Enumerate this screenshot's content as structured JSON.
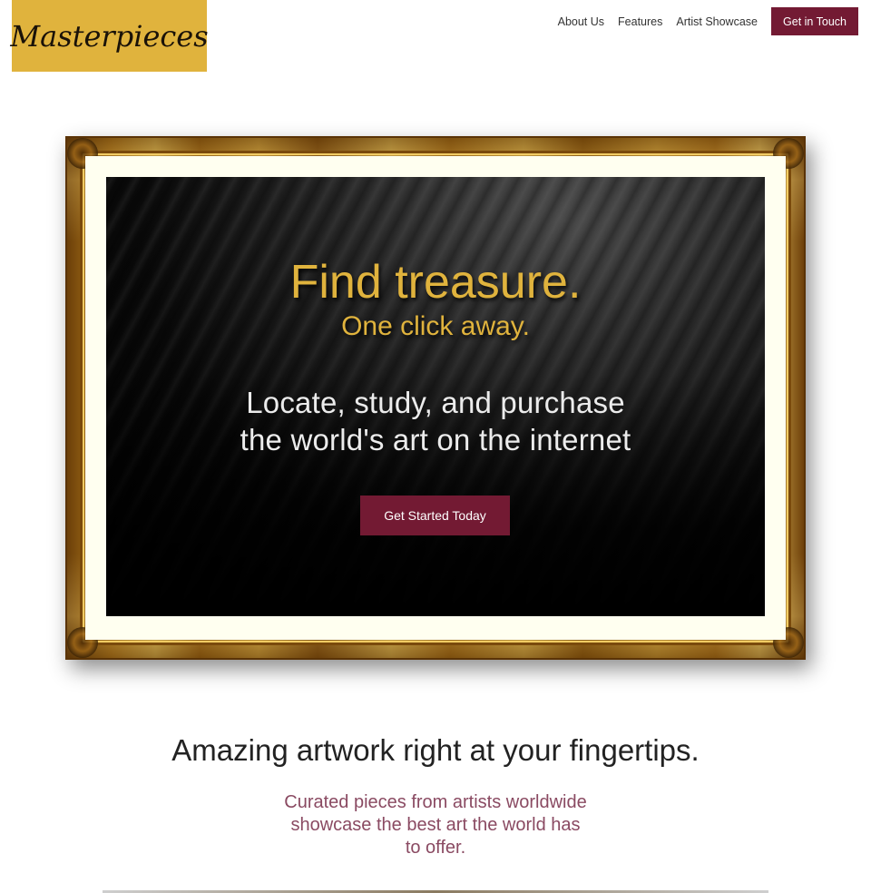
{
  "header": {
    "logo_text": "Masterpieces",
    "nav": [
      {
        "label": "About Us"
      },
      {
        "label": "Features"
      },
      {
        "label": "Artist Showcase"
      }
    ],
    "cta_label": "Get in Touch"
  },
  "hero": {
    "title": "Find treasure.",
    "subtitle": "One click away.",
    "description_line1": "Locate, study, and purchase",
    "description_line2": "the world's art on the internet",
    "button_label": "Get Started Today"
  },
  "features": {
    "heading": "Amazing artwork right at your fingertips.",
    "description_line1": "Curated pieces from artists worldwide",
    "description_line2": "showcase the best art the world has",
    "description_line3": "to offer."
  },
  "colors": {
    "accent_gold": "#e0b33d",
    "accent_maroon": "#731a33",
    "text_muted_maroon": "#8a4a62"
  }
}
